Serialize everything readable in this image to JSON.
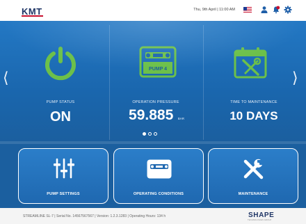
{
  "header": {
    "logo": "KMT",
    "datetime": "Thu, 9th April  |  11:00 AM",
    "icons": [
      "us-flag-icon",
      "user-icon",
      "notification-icon",
      "settings-gear-icon"
    ]
  },
  "carousel": {
    "prev_arrow": "⟨",
    "next_arrow": "⟩",
    "cards": [
      {
        "label": "PUMP STATUS",
        "value": "ON",
        "icon": "power-icon"
      },
      {
        "label": "OPERATION PRESSURE",
        "value": "59.885",
        "unit": "BAR",
        "icon": "pump-icon",
        "icon_text": "PUMP 4"
      },
      {
        "label": "TIME TO MAINTENANCE",
        "value": "10 DAYS",
        "icon": "calendar-tools-icon"
      }
    ],
    "page_dots": 3,
    "active_dot": 0
  },
  "tiles": [
    {
      "label": "PUMP SETTINGS",
      "icon": "sliders-icon"
    },
    {
      "label": "OPERATING CONDITIONS",
      "icon": "pump-gauge-icon"
    },
    {
      "label": "MAINTENANCE",
      "icon": "wrench-screwdriver-icon"
    }
  ],
  "footer": {
    "text": "STREAMLINE SL-7  |  Serial No. 14567567567  |  Version: 1.2.3.1283  |  Operating Hours: 134 h",
    "brand": "SHAPE",
    "brand_sub": "TECHNOLOGIES GROUP"
  },
  "colors": {
    "power_green": "#6cc04a",
    "panel_blue": "#1b66ad",
    "accent_red": "#c8102e",
    "navy": "#1f3566"
  }
}
